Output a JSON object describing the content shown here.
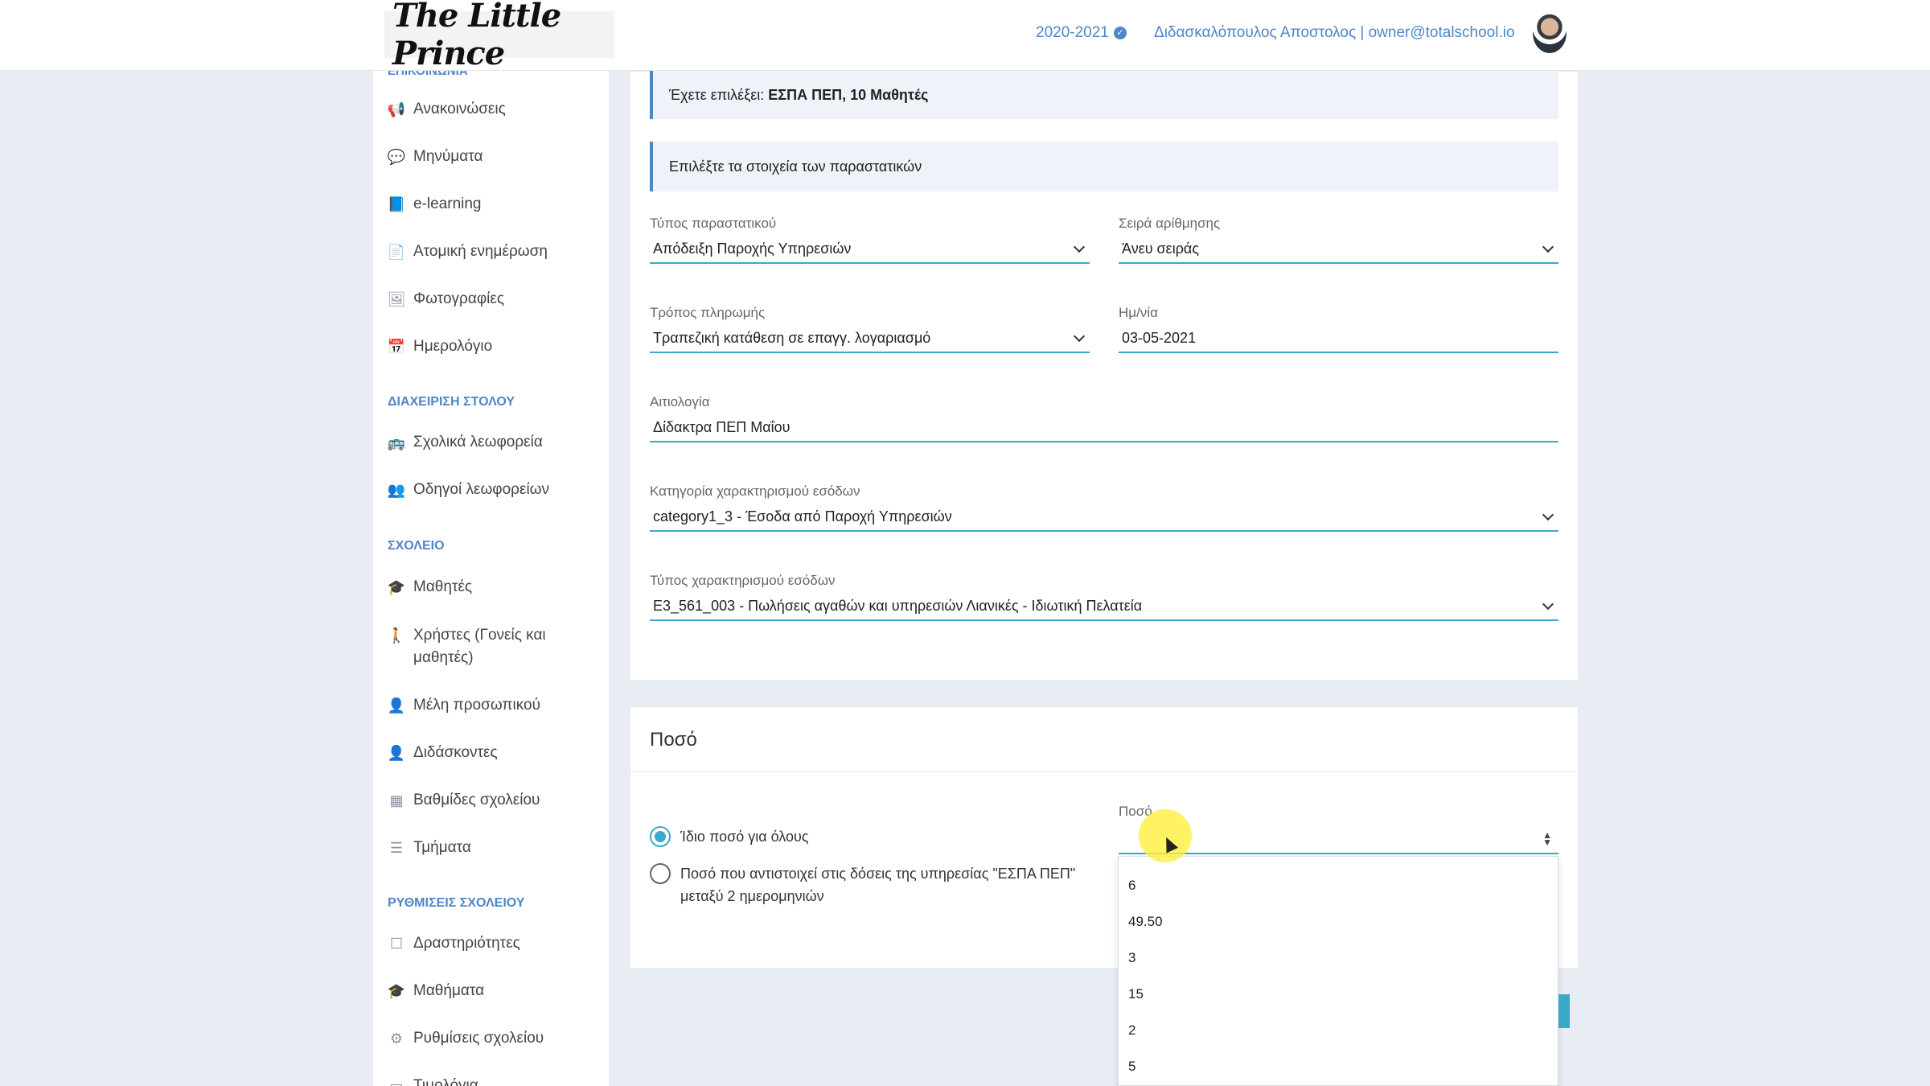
{
  "header": {
    "logo_text": "The Little Prince",
    "year": "2020-2021",
    "user": "Διδασκαλόπουλος Αποστολος | owner@totalschool.io"
  },
  "sidebar": {
    "cut_heading": "ΕΠΙΚΟΙΝΩΝΙΑ",
    "items_comm": [
      {
        "label": "Ανακοινώσεις",
        "icon": "megaphone-icon"
      },
      {
        "label": "Μηνύματα",
        "icon": "chat-icon"
      },
      {
        "label": "e-learning",
        "icon": "book-icon"
      },
      {
        "label": "Ατομική ενημέρωση",
        "icon": "document-icon"
      },
      {
        "label": "Φωτογραφίες",
        "icon": "image-icon"
      },
      {
        "label": "Ημερολόγιο",
        "icon": "calendar-icon"
      }
    ],
    "section_fleet": "ΔΙΑΧΕΙΡΙΣΗ ΣΤΟΛΟΥ",
    "items_fleet": [
      {
        "label": "Σχολικά λεωφορεία",
        "icon": "bus-icon"
      },
      {
        "label": "Οδηγοί λεωφορείων",
        "icon": "users-icon"
      }
    ],
    "section_school": "ΣΧΟΛΕΙΟ",
    "items_school": [
      {
        "label": "Μαθητές",
        "icon": "graduation-cap-icon"
      },
      {
        "label": "Χρήστες (Γονείς και μαθητές)",
        "icon": "child-icon"
      },
      {
        "label": "Μέλη προσωπικού",
        "icon": "user-circle-icon"
      },
      {
        "label": "Διδάσκοντες",
        "icon": "user-circle-icon"
      },
      {
        "label": "Βαθμίδες σχολείου",
        "icon": "sitemap-icon"
      },
      {
        "label": "Τμήματα",
        "icon": "list-icon"
      }
    ],
    "section_settings": "ΡΥΘΜΙΣΕΙΣ ΣΧΟΛΕΙΟΥ",
    "items_settings": [
      {
        "label": "Δραστηριότητες",
        "icon": "square-icon"
      },
      {
        "label": "Μαθήματα",
        "icon": "graduation-cap-icon"
      },
      {
        "label": "Ρυθμίσεις σχολείου",
        "icon": "gears-icon"
      },
      {
        "label": "Τιμολόγια",
        "icon": "card-icon"
      }
    ]
  },
  "form": {
    "selected_prefix": "Έχετε επιλέξει:",
    "selected_value": "ΕΣΠΑ ΠΕΠ, 10 Μαθητές",
    "instruction": "Επιλέξτε τα στοιχεία των παραστατικών",
    "doc_type_label": "Τύπος παραστατικού",
    "doc_type_value": "Απόδειξη Παροχής Υπηρεσιών",
    "series_label": "Σειρά αρίθμησης",
    "series_value": "Άνευ σειράς",
    "payment_label": "Τρόπος πληρωμής",
    "payment_value": "Τραπεζική κατάθεση σε επαγγ. λογαριασμό",
    "date_label": "Ημ/νία",
    "date_value": "03-05-2021",
    "reason_label": "Αιτιολογία",
    "reason_value": "Δίδακτρα ΠΕΠ Μαΐου",
    "income_cat_label": "Κατηγορία χαρακτηρισμού εσόδων",
    "income_cat_value": "category1_3 - Έσοδα από Παροχή Υπηρεσιών",
    "income_type_label": "Τύπος χαρακτηρισμού εσόδων",
    "income_type_value": "E3_561_003 - Πωλήσεις αγαθών και υπηρεσιών Λιανικές - Ιδιωτική Πελατεία"
  },
  "amount": {
    "title": "Ποσό",
    "radio_same": "Ίδιο ποσό για όλους",
    "radio_installments": "Ποσό που αντιστοιχεί στις δόσεις της υπηρεσίας \"ΕΣΠΑ ΠΕΠ\" μεταξύ 2 ημερομηνιών",
    "field_label": "Ποσό",
    "field_value": "",
    "options": [
      "6",
      "49.50",
      "3",
      "15",
      "2",
      "5"
    ]
  }
}
